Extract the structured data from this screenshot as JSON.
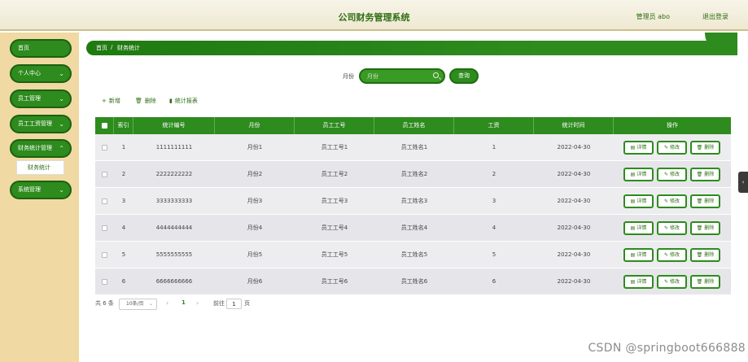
{
  "header": {
    "title": "公司财务管理系统",
    "admin_label": "管理员 abo",
    "logout_label": "退出登录"
  },
  "sidebar": {
    "items": [
      {
        "label": "首页",
        "icon": "none"
      },
      {
        "label": "个人中心",
        "icon": "chevron-down-icon"
      },
      {
        "label": "员工管理",
        "icon": "chevron-down-icon"
      },
      {
        "label": "员工工资管理",
        "icon": "chevron-down-icon"
      },
      {
        "label": "财务统计管理",
        "icon": "chevron-down-icon"
      },
      {
        "label": "系统管理",
        "icon": "chevron-down-icon"
      }
    ],
    "submenu_label": "财务统计"
  },
  "breadcrumb": {
    "home": "首页",
    "separator": "/",
    "current": "财务统计"
  },
  "search": {
    "label": "月份",
    "placeholder": "月份",
    "button": "查询"
  },
  "actions": {
    "add": "新增",
    "delete": "删除",
    "report": "统计报表"
  },
  "table": {
    "headers": [
      "索引",
      "统计编号",
      "月份",
      "员工工号",
      "员工姓名",
      "工资",
      "统计时间",
      "操作"
    ],
    "rows": [
      {
        "index": "1",
        "code": "1111111111",
        "month": "月份1",
        "emp_no": "员工工号1",
        "emp_name": "员工姓名1",
        "salary": "1",
        "time": "2022-04-30"
      },
      {
        "index": "2",
        "code": "2222222222",
        "month": "月份2",
        "emp_no": "员工工号2",
        "emp_name": "员工姓名2",
        "salary": "2",
        "time": "2022-04-30"
      },
      {
        "index": "3",
        "code": "3333333333",
        "month": "月份3",
        "emp_no": "员工工号3",
        "emp_name": "员工姓名3",
        "salary": "3",
        "time": "2022-04-30"
      },
      {
        "index": "4",
        "code": "4444444444",
        "month": "月份4",
        "emp_no": "员工工号4",
        "emp_name": "员工姓名4",
        "salary": "4",
        "time": "2022-04-30"
      },
      {
        "index": "5",
        "code": "5555555555",
        "month": "月份5",
        "emp_no": "员工工号5",
        "emp_name": "员工姓名5",
        "salary": "5",
        "time": "2022-04-30"
      },
      {
        "index": "6",
        "code": "6666666666",
        "month": "月份6",
        "emp_no": "员工工号6",
        "emp_name": "员工姓名6",
        "salary": "6",
        "time": "2022-04-30"
      }
    ],
    "row_buttons": {
      "detail": "详情",
      "edit": "修改",
      "delete": "删除"
    }
  },
  "pagination": {
    "total": "共 6 条",
    "page_size": "10条/页",
    "current_page": "1",
    "goto_prefix": "前往",
    "goto_value": "1",
    "goto_suffix": "页"
  },
  "watermark": "CSDN @springboot666888",
  "colors": {
    "accent": "#2e8b1e",
    "sidebar_bg": "#f0d9a2",
    "header_bg": "#f3efdc"
  }
}
